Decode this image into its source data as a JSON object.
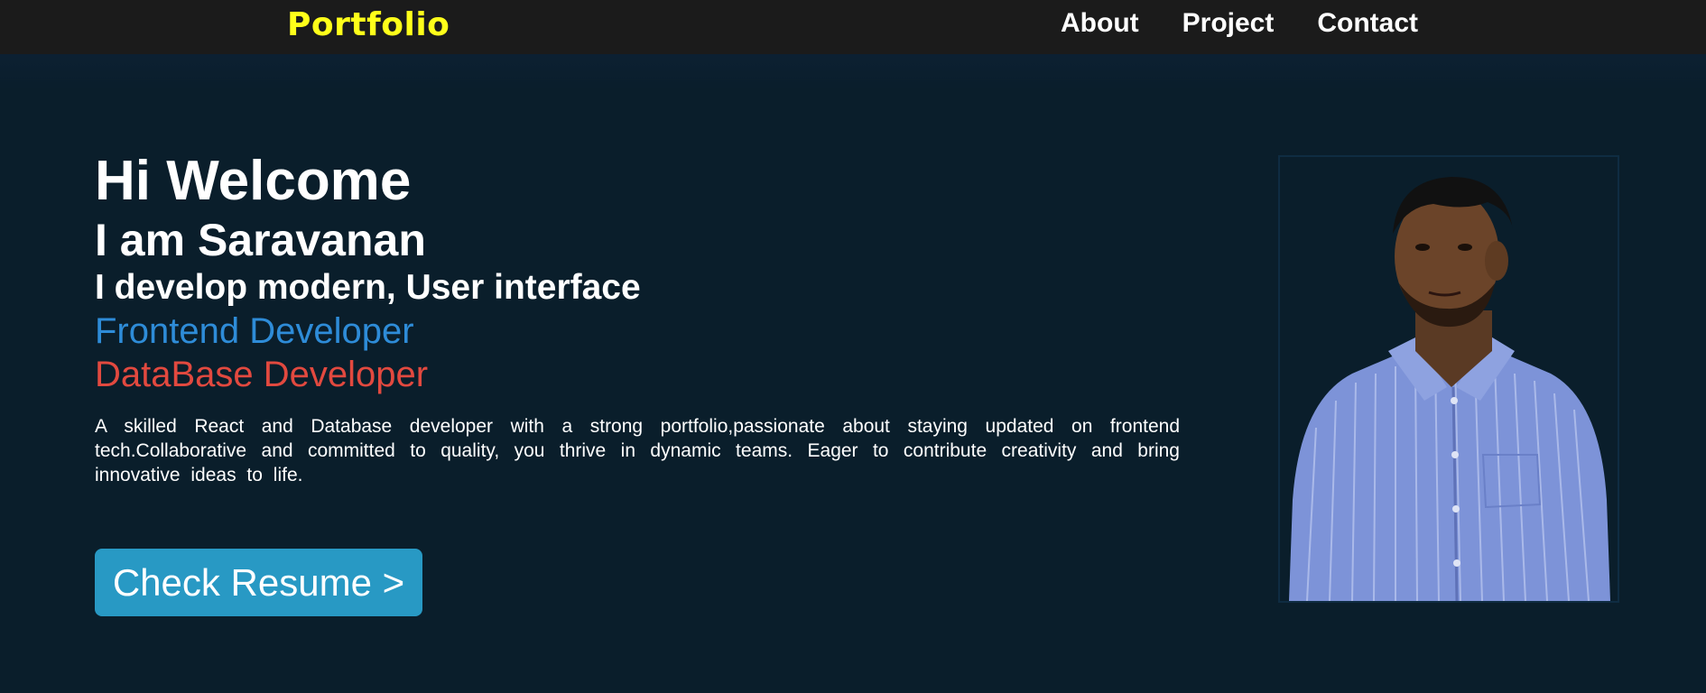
{
  "navbar": {
    "brand": "Portfolio",
    "links": [
      "About",
      "Project",
      "Contact"
    ]
  },
  "hero": {
    "greeting": "Hi Welcome",
    "name_line": "I am Saravanan",
    "tagline": "I develop modern, User interface",
    "role_frontend": "Frontend Developer",
    "role_database": "DataBase Developer",
    "bio": "A skilled React and Database developer with a strong portfolio,passionate about staying updated on frontend tech.Collaborative and committed to quality, you thrive in dynamic teams. Eager to contribute creativity and bring innovative ideas to life.",
    "resume_button": "Check Resume >"
  },
  "profile_photo": {
    "subject": "portrait-photo"
  },
  "colors": {
    "background": "#0a1e2b",
    "navbar": "#1b1b1b",
    "brand": "#ffff1a",
    "frontend_role": "#2e8cd8",
    "database_role": "#e2493f",
    "button": "#2899c4"
  }
}
